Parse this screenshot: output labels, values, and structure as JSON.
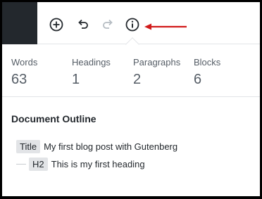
{
  "toolbar": {
    "add_icon": "plus-circle-icon",
    "undo_icon": "undo-icon",
    "redo_icon": "redo-icon",
    "info_icon": "info-icon",
    "arrow_color": "#d11a1a"
  },
  "stats": [
    {
      "label": "Words",
      "value": "63"
    },
    {
      "label": "Headings",
      "value": "1"
    },
    {
      "label": "Paragraphs",
      "value": "2"
    },
    {
      "label": "Blocks",
      "value": "6"
    }
  ],
  "outline": {
    "title": "Document Outline",
    "items": [
      {
        "tag": "Title",
        "text": "My first blog post with Gutenberg"
      },
      {
        "tag": "H2",
        "text": "This is my first heading"
      }
    ]
  }
}
